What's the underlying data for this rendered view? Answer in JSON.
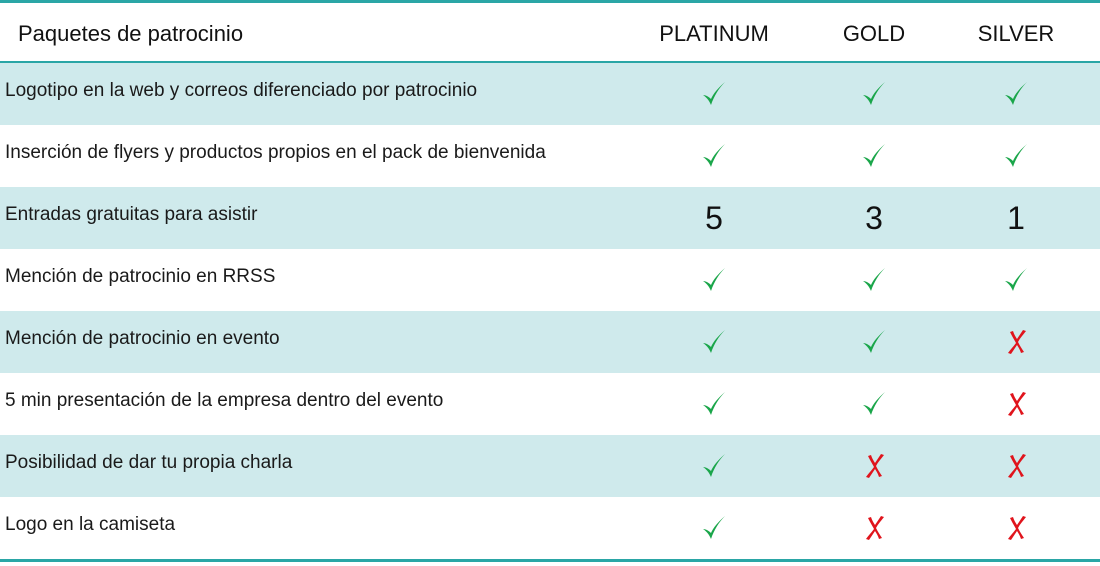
{
  "header": {
    "title": "Paquetes de patrocinio",
    "columns": [
      "PLATINUM",
      "GOLD",
      "SILVER"
    ]
  },
  "colors": {
    "accent": "#2aa6a6",
    "shade": "#cfeaec",
    "check": "#1aa64a",
    "cross": "#e0141c"
  },
  "rows": [
    {
      "label": "Logotipo en la web y correos diferenciado por patrocinio",
      "values": [
        "check",
        "check",
        "check"
      ]
    },
    {
      "label": "Inserción de flyers y productos propios en el pack de bienvenida",
      "values": [
        "check",
        "check",
        "check"
      ]
    },
    {
      "label": "Entradas gratuitas para asistir",
      "values": [
        "5",
        "3",
        "1"
      ]
    },
    {
      "label": "Mención de patrocinio en RRSS",
      "values": [
        "check",
        "check",
        "check"
      ]
    },
    {
      "label": "Mención de patrocinio en evento",
      "values": [
        "check",
        "check",
        "cross"
      ]
    },
    {
      "label": "5 min presentación de la empresa dentro del evento",
      "values": [
        "check",
        "check",
        "cross"
      ]
    },
    {
      "label": "Posibilidad de dar tu propia charla",
      "values": [
        "check",
        "cross",
        "cross"
      ]
    },
    {
      "label": "Logo en la camiseta",
      "values": [
        "check",
        "cross",
        "cross"
      ]
    }
  ]
}
